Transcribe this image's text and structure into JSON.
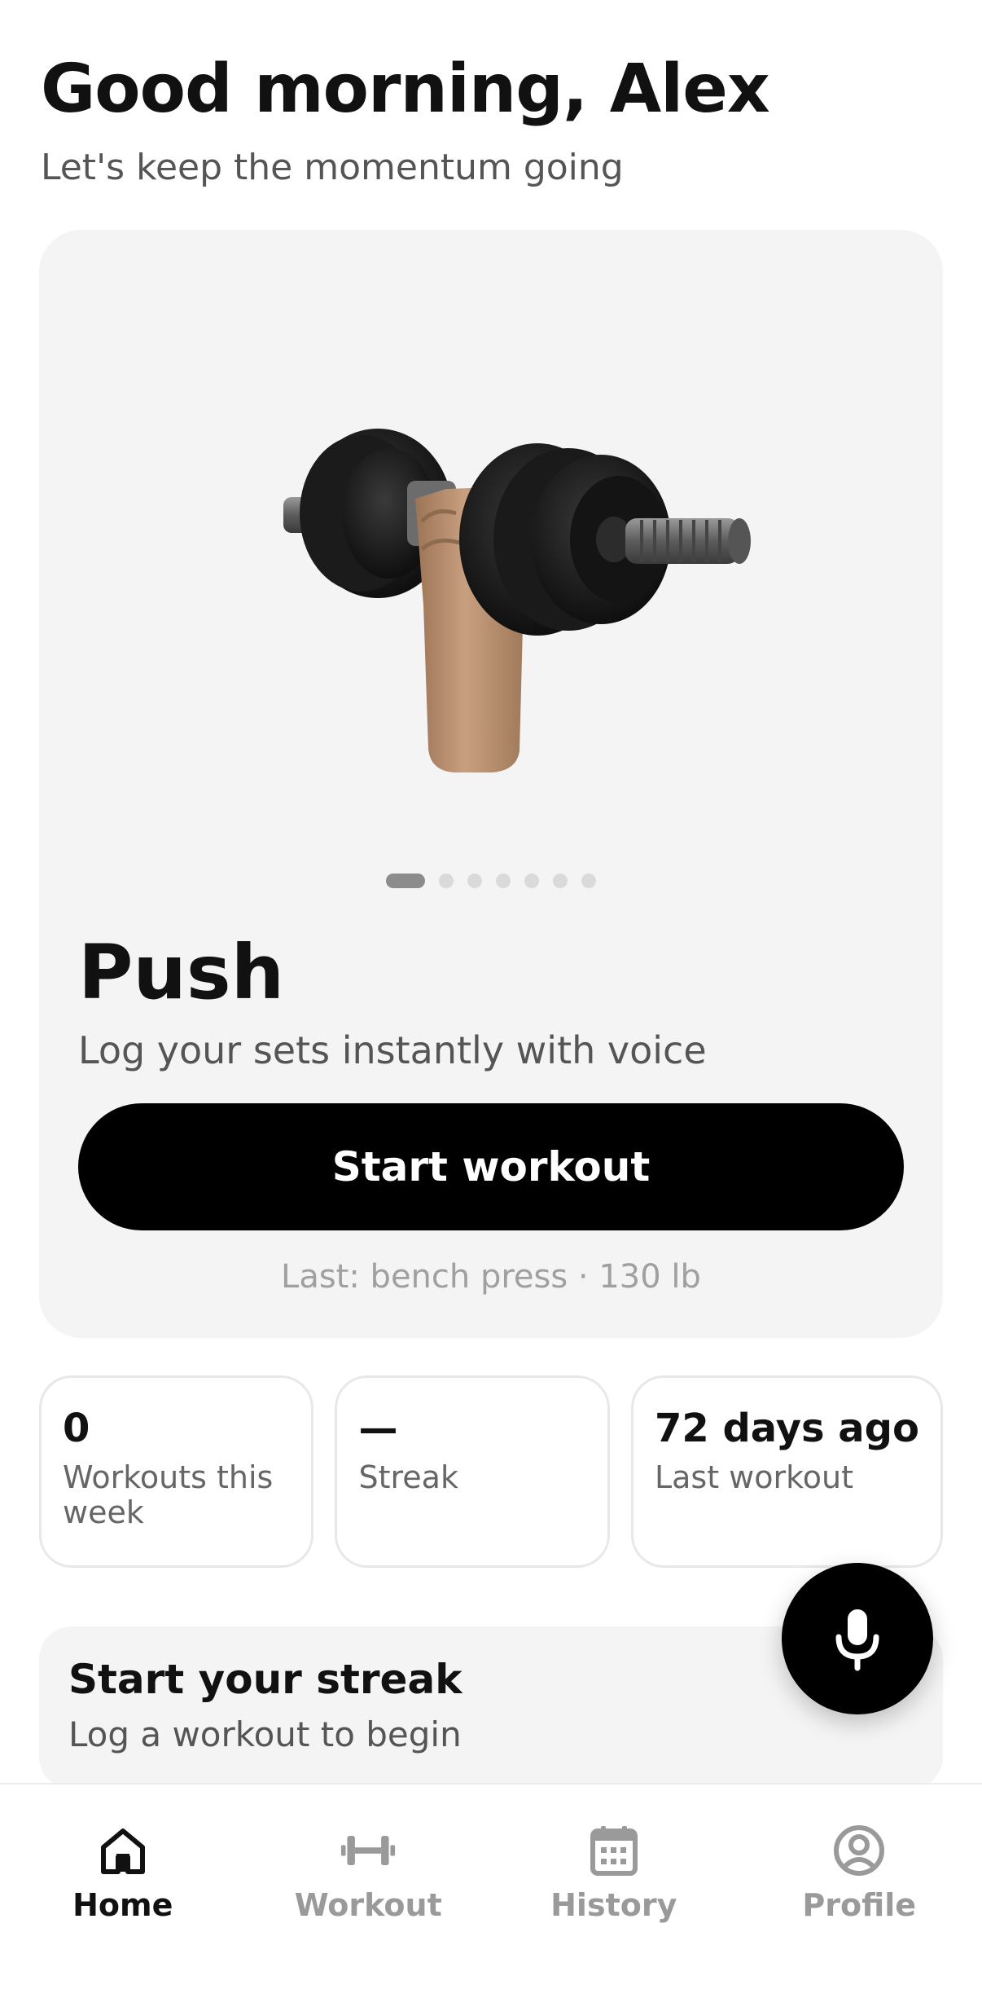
{
  "header": {
    "greeting": "Good morning, Alex",
    "subtitle": "Let's keep the momentum going"
  },
  "hero": {
    "image_icon": "dumbbell-in-hand-illustration",
    "carousel": {
      "total": 7,
      "active_index": 0
    },
    "title": "Push",
    "subtitle": "Log your sets instantly with voice",
    "button_label": "Start workout",
    "last_text": "Last: bench press · 130 lb"
  },
  "stats": [
    {
      "value": "0",
      "label": "Workouts this week"
    },
    {
      "value": "—",
      "label": "Streak"
    },
    {
      "value": "72 days ago",
      "label": "Last workout"
    }
  ],
  "streak_card": {
    "title": "Start your streak",
    "subtitle": "Log a workout to begin"
  },
  "mic_button": {
    "icon": "microphone-icon"
  },
  "tabbar": {
    "active": "home",
    "items": [
      {
        "id": "home",
        "label": "Home",
        "icon": "home-icon"
      },
      {
        "id": "workout",
        "label": "Workout",
        "icon": "dumbbell-icon"
      },
      {
        "id": "history",
        "label": "History",
        "icon": "calendar-icon"
      },
      {
        "id": "profile",
        "label": "Profile",
        "icon": "profile-icon"
      }
    ]
  },
  "colors": {
    "primary": "#000000",
    "card_bg": "#f4f4f4",
    "text": "#111111",
    "muted": "#9a9a9a"
  }
}
